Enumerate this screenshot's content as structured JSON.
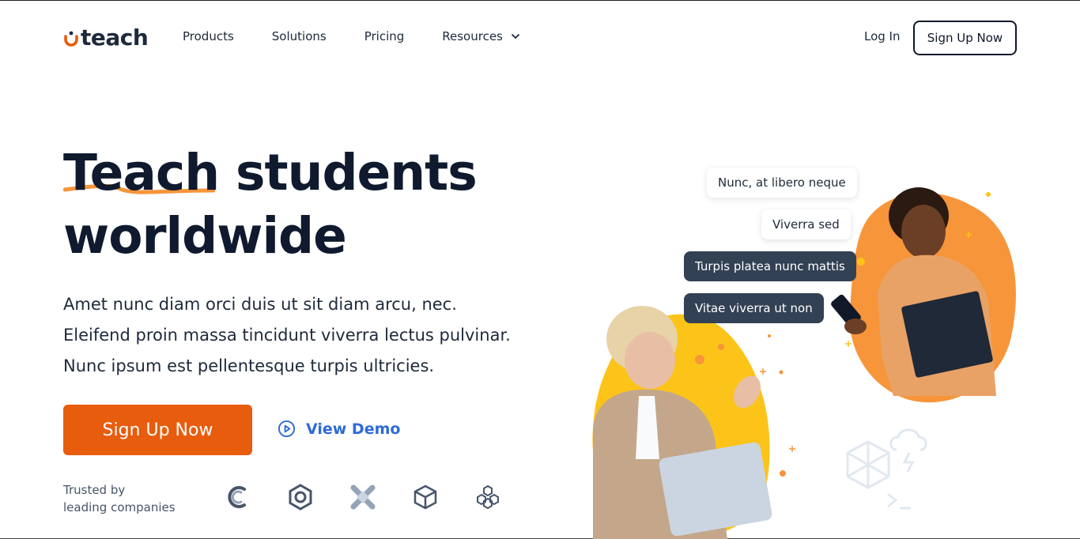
{
  "brand": {
    "name": "teach",
    "accent": "#e85c0d"
  },
  "nav": {
    "items": [
      {
        "label": "Products"
      },
      {
        "label": "Solutions"
      },
      {
        "label": "Pricing"
      },
      {
        "label": "Resources"
      }
    ],
    "login": "Log In",
    "signup": "Sign Up Now"
  },
  "hero": {
    "headline_word1": "Teach",
    "headline_rest1": " students",
    "headline_line2": "worldwide",
    "lead_lines": [
      "Amet nunc diam orci duis ut sit diam arcu, nec.",
      "Eleifend proin massa tincidunt viverra lectus pulvinar.",
      "Nunc ipsum est pellentesque turpis ultricies."
    ],
    "cta": "Sign Up Now",
    "demo": "View Demo",
    "trusted_line1": "Trusted by",
    "trusted_line2": "leading companies"
  },
  "chat": [
    {
      "text": "Nunc, at libero neque",
      "style": "light"
    },
    {
      "text": "Viverra sed",
      "style": "light"
    },
    {
      "text": "Turpis platea nunc mattis",
      "style": "dark"
    },
    {
      "text": "Vitae viverra ut non",
      "style": "dark"
    }
  ],
  "company_logos": [
    "c-logo-icon",
    "hexagon-logo-icon",
    "x-logo-icon",
    "cube-logo-icon",
    "honeycomb-logo-icon"
  ],
  "colors": {
    "orange_blob": "#f7953a",
    "yellow_blob": "#fcc419",
    "dark_text": "#0f1a2e",
    "link_blue": "#2d6ad6"
  }
}
